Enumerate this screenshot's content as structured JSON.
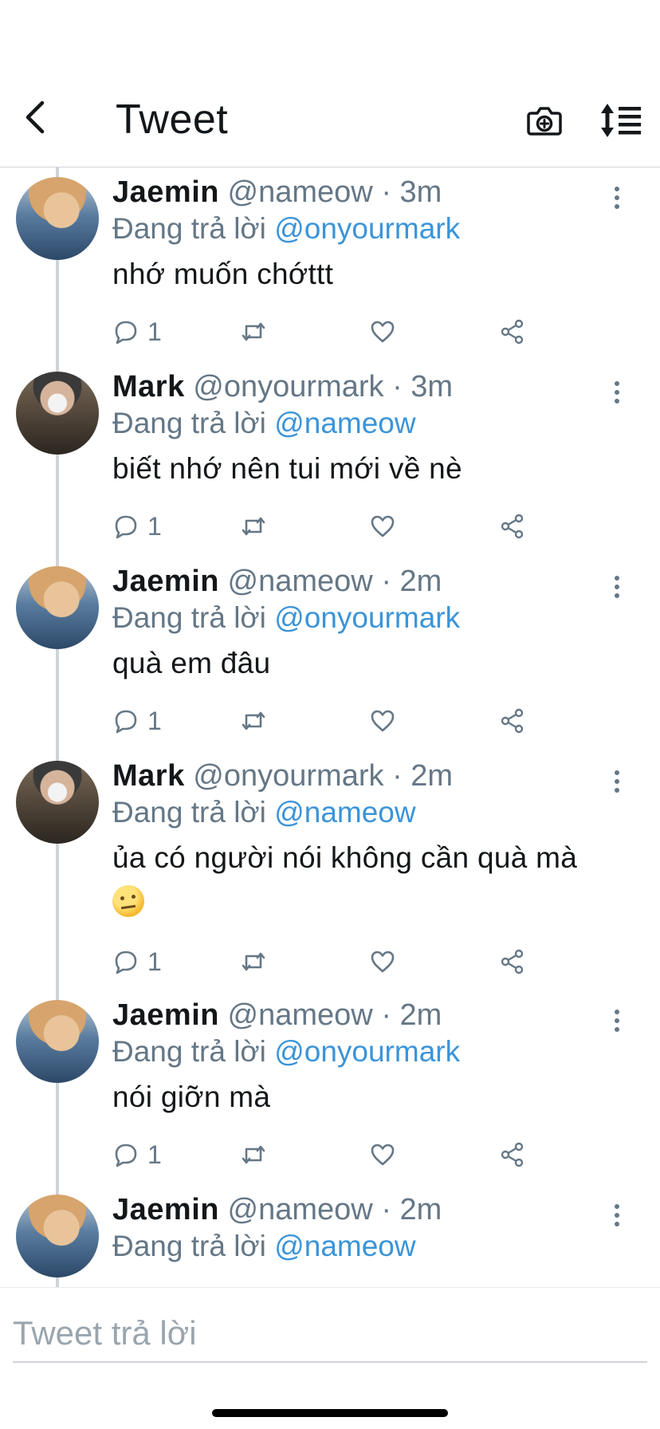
{
  "header": {
    "title": "Tweet",
    "back_icon": "chevron-left-icon",
    "camera_icon": "camera-plus-icon",
    "sort_icon": "sort-list-icon"
  },
  "colors": {
    "accent": "#3b94d9",
    "secondary_text": "#657786",
    "primary_text": "#14171a",
    "divider": "#cfd4d8"
  },
  "tweets": [
    {
      "name": "Jaemin",
      "handle": "@nameow",
      "separator": "·",
      "time": "3m",
      "replying_label": "Đang trả lời",
      "mention": "@onyourmark",
      "text": "nhớ muốn chớttt",
      "reply_count": "1"
    },
    {
      "name": "Mark",
      "handle": "@onyourmark",
      "separator": "·",
      "time": "3m",
      "replying_label": "Đang trả lời",
      "mention": "@nameow",
      "text": "biết nhớ nên tui mới về nè",
      "reply_count": "1"
    },
    {
      "name": "Jaemin",
      "handle": "@nameow",
      "separator": "·",
      "time": "2m",
      "replying_label": "Đang trả lời",
      "mention": "@onyourmark",
      "text": "quà em đâu",
      "reply_count": "1"
    },
    {
      "name": "Mark",
      "handle": "@onyourmark",
      "separator": "·",
      "time": "2m",
      "replying_label": "Đang trả lời",
      "mention": "@nameow",
      "text": "ủa có người nói không cần quà mà",
      "emoji": "raised-eyebrow-emoji",
      "reply_count": "1"
    },
    {
      "name": "Jaemin",
      "handle": "@nameow",
      "separator": "·",
      "time": "2m",
      "replying_label": "Đang trả lời",
      "mention": "@onyourmark",
      "text": "nói giỡn mà",
      "reply_count": "1"
    },
    {
      "name": "Jaemin",
      "handle": "@nameow",
      "separator": "·",
      "time": "2m",
      "replying_label": "Đang trả lời",
      "mention": "@nameow"
    }
  ],
  "reply_bar": {
    "placeholder": "Tweet trả lời"
  }
}
